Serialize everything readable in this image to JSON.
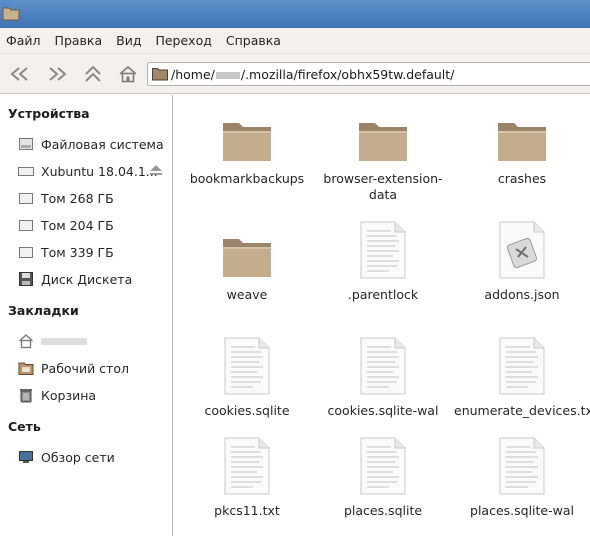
{
  "menubar": {
    "items": [
      "Файл",
      "Правка",
      "Вид",
      "Переход",
      "Справка"
    ]
  },
  "toolbar": {
    "path_prefix": "/home/",
    "path_suffix": "/.mozilla/firefox/obhx59tw.default/"
  },
  "sidebar": {
    "devices_title": "Устройства",
    "devices": [
      {
        "label": "Файловая система",
        "icon": "filesystem-icon"
      },
      {
        "label": "Xubuntu 18.04.1...",
        "icon": "drive-icon"
      },
      {
        "label": "Том 268 ГБ",
        "icon": "drive-icon"
      },
      {
        "label": "Том 204 ГБ",
        "icon": "drive-icon"
      },
      {
        "label": "Том 339 ГБ",
        "icon": "drive-icon"
      },
      {
        "label": "Диск Дискета",
        "icon": "floppy-icon"
      }
    ],
    "bookmarks_title": "Закладки",
    "bookmarks": [
      {
        "label": "",
        "icon": "home-icon"
      },
      {
        "label": "Рабочий стол",
        "icon": "desktop-icon"
      },
      {
        "label": "Корзина",
        "icon": "trash-icon"
      }
    ],
    "network_title": "Сеть",
    "network": [
      {
        "label": "Обзор сети",
        "icon": "network-icon"
      }
    ]
  },
  "files": [
    {
      "name": "bookmarkbackups",
      "type": "folder"
    },
    {
      "name": "browser-extension-data",
      "type": "folder"
    },
    {
      "name": "crashes",
      "type": "folder"
    },
    {
      "name": "weave",
      "type": "folder"
    },
    {
      "name": ".parentlock",
      "type": "text"
    },
    {
      "name": "addons.json",
      "type": "json"
    },
    {
      "name": "cookies.sqlite",
      "type": "text"
    },
    {
      "name": "cookies.sqlite-wal",
      "type": "text"
    },
    {
      "name": "enumerate_devices.txt",
      "type": "text"
    },
    {
      "name": "pkcs11.txt",
      "type": "text"
    },
    {
      "name": "places.sqlite",
      "type": "text"
    },
    {
      "name": "places.sqlite-wal",
      "type": "text"
    }
  ]
}
